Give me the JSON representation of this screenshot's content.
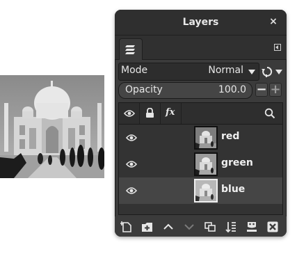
{
  "panel": {
    "title": "Layers",
    "close_glyph": "×"
  },
  "tabs": {
    "active_tab_icon": "layers-icon",
    "menu_icon": "tab-menu-icon"
  },
  "mode": {
    "label": "Mode",
    "value": "Normal",
    "composite_icon": "composite-mode-icon"
  },
  "opacity": {
    "label": "Opacity",
    "value": "100.0",
    "fill_fraction": 1.0,
    "minus_label": "−",
    "plus_label": "+"
  },
  "list_header": {
    "icons": [
      "eye-icon",
      "lock-icon",
      "fx-icon",
      "search-icon"
    ],
    "fx_label": "fx"
  },
  "layers": [
    {
      "name": "red",
      "visible": true,
      "selected": false
    },
    {
      "name": "green",
      "visible": true,
      "selected": false
    },
    {
      "name": "blue",
      "visible": true,
      "selected": true
    }
  ],
  "bottom_toolbar": {
    "icons": [
      "new-layer-icon",
      "new-group-icon",
      "raise-layer-icon",
      "lower-layer-icon",
      "duplicate-layer-icon",
      "merge-down-icon",
      "add-mask-icon",
      "delete-layer-icon"
    ]
  },
  "colors": {
    "panel_bg": "#3b3b3b",
    "selected_row": "#454545",
    "text": "#e6e6e6"
  }
}
